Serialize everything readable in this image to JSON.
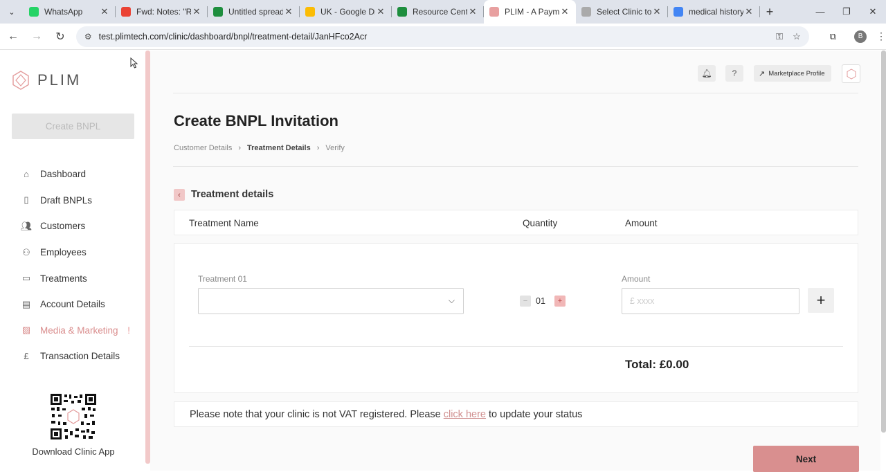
{
  "browser": {
    "tabs": [
      {
        "title": "WhatsApp",
        "icon": "whatsapp-icon",
        "color": "#25d366",
        "active": false
      },
      {
        "title": "Fwd: Notes: \"Re:",
        "icon": "gmail-icon",
        "color": "#ea4335",
        "active": false
      },
      {
        "title": "Untitled spreadsheet",
        "icon": "sheets-icon",
        "color": "#1e8e3e",
        "active": false
      },
      {
        "title": "UK - Google Drive",
        "icon": "drive-icon",
        "color": "#fbbc04",
        "active": false
      },
      {
        "title": "Resource Centre",
        "icon": "sheets-icon",
        "color": "#1e8e3e",
        "active": false
      },
      {
        "title": "PLIM - A Payment",
        "icon": "plim-icon",
        "color": "#e8a0a0",
        "active": true
      },
      {
        "title": "Select Clinic to c",
        "icon": "plim-icon",
        "color": "#aaaaaa",
        "active": false
      },
      {
        "title": "medical history",
        "icon": "google-icon",
        "color": "#4285f4",
        "active": false
      }
    ],
    "url": "test.plimtech.com/clinic/dashboard/bnpl/treatment-detail/JanHFco2Acr",
    "profile_initial": "B"
  },
  "sidebar": {
    "logo_text": "PLIM",
    "create_button": "Create BNPL",
    "items": [
      {
        "label": "Dashboard",
        "icon": "home-icon",
        "active": false
      },
      {
        "label": "Draft BNPLs",
        "icon": "document-icon",
        "active": false
      },
      {
        "label": "Customers",
        "icon": "users-icon",
        "active": false
      },
      {
        "label": "Employees",
        "icon": "user-plus-icon",
        "active": false
      },
      {
        "label": "Treatments",
        "icon": "treatments-icon",
        "active": false
      },
      {
        "label": "Account Details",
        "icon": "id-card-icon",
        "active": false
      },
      {
        "label": "Media & Marketing",
        "icon": "image-icon",
        "active": true,
        "badge": "!"
      },
      {
        "label": "Transaction Details",
        "icon": "pound-icon",
        "active": false
      }
    ],
    "download_label": "Download Clinic App"
  },
  "header": {
    "marketplace_label": "Marketplace Profile"
  },
  "page": {
    "title": "Create BNPL Invitation",
    "breadcrumb": [
      "Customer Details",
      "Treatment Details",
      "Verify"
    ],
    "section_title": "Treatment details",
    "table_headers": {
      "name": "Treatment Name",
      "quantity": "Quantity",
      "amount": "Amount"
    },
    "row": {
      "treatment_label": "Treatment 01",
      "treatment_value": "",
      "quantity": "01",
      "amount_label": "Amount",
      "amount_placeholder": "£ xxxx"
    },
    "total": "Total: £0.00",
    "vat_note_prefix": "Please note that your clinic is not VAT registered. Please",
    "vat_note_link": "click here",
    "vat_note_suffix": "to update your status",
    "next_button": "Next"
  },
  "colors": {
    "accent": "#d98f8f",
    "active_nav": "#d98c8c"
  }
}
